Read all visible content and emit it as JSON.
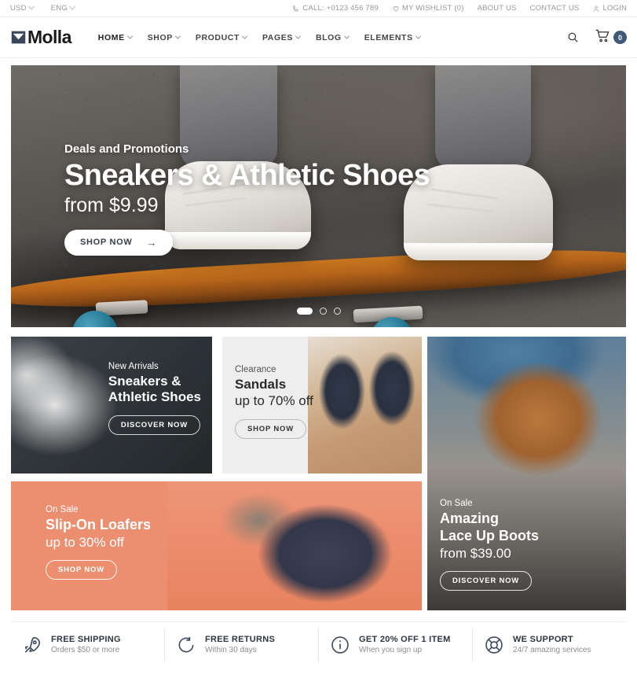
{
  "topbar": {
    "currency": "USD",
    "language": "ENG",
    "phone": "CALL: +0123 456 789",
    "wishlist": "MY WISHLIST (0)",
    "about": "ABOUT US",
    "contact": "CONTACT US",
    "login": "LOGIN",
    "icons": {
      "phone": "phone-icon",
      "wishlist": "heart-icon",
      "login": "user-icon"
    }
  },
  "header": {
    "logo_text": "Molla",
    "logo_mark": "molla-m-icon",
    "nav": [
      {
        "label": "HOME",
        "has_caret": true
      },
      {
        "label": "SHOP",
        "has_caret": true
      },
      {
        "label": "PRODUCT",
        "has_caret": true
      },
      {
        "label": "PAGES",
        "has_caret": true
      },
      {
        "label": "BLOG",
        "has_caret": true
      },
      {
        "label": "ELEMENTS",
        "has_caret": true
      }
    ],
    "search_icon": "search-icon",
    "cart_icon": "cart-icon",
    "cart_count": "0",
    "cart_badge_color": "#3f5977"
  },
  "hero": {
    "kicker": "Deals and Promotions",
    "title": "Sneakers & Athletic Shoes",
    "price": "from $9.99",
    "cta": "SHOP NOW",
    "cta_arrow": "→",
    "slides": 3,
    "active_slide": 1
  },
  "promos": {
    "sneakers": {
      "kicker": "New Arrivals",
      "title_line1": "Sneakers &",
      "title_line2": "Athletic Shoes",
      "cta": "DISCOVER NOW"
    },
    "sandals": {
      "kicker": "Clearance",
      "title": "Sandals",
      "subtitle": "up to 70% off",
      "cta": "SHOP NOW"
    },
    "boots": {
      "kicker": "On Sale",
      "title_line1": "Amazing",
      "title_line2": "Lace Up Boots",
      "subtitle": "from $39.00",
      "cta": "DISCOVER NOW"
    },
    "loafers": {
      "kicker": "On Sale",
      "title": "Slip-On Loafers",
      "subtitle": "up to 30% off",
      "cta": "SHOP NOW",
      "bg_color": "#ec8e70"
    }
  },
  "features": [
    {
      "icon": "rocket-icon",
      "title": "FREE SHIPPING",
      "subtitle": "Orders $50 or more"
    },
    {
      "icon": "rotate-arrow-icon",
      "title": "FREE RETURNS",
      "subtitle": "Within 30 days"
    },
    {
      "icon": "info-circle-icon",
      "title": "GET 20% OFF 1 ITEM",
      "subtitle": "When you sign up"
    },
    {
      "icon": "lifebuoy-icon",
      "title": "WE SUPPORT",
      "subtitle": "24/7 amazing services"
    }
  ]
}
